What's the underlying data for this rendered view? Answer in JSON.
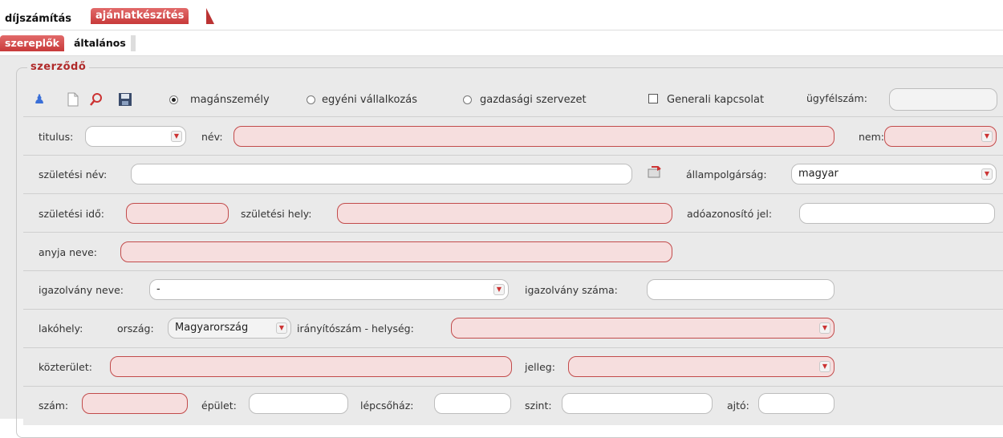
{
  "tabs": {
    "main": [
      {
        "label": "díjszámítás"
      },
      {
        "label": "ajánlatkészítés"
      }
    ],
    "sub": [
      {
        "label": "szereplők"
      },
      {
        "label": "általános"
      }
    ]
  },
  "section": {
    "title": "szerződő",
    "radios": [
      {
        "label": "magánszemély",
        "selected": true
      },
      {
        "label": "egyéni vállalkozás",
        "selected": false
      },
      {
        "label": "gazdasági szervezet",
        "selected": false
      }
    ],
    "generali_checkbox": {
      "label": "Generali kapcsolat",
      "checked": false
    },
    "client_id_label": "ügyfélszám:"
  },
  "fields": {
    "titulus": {
      "label": "titulus:",
      "value": ""
    },
    "nev": {
      "label": "név:",
      "value": ""
    },
    "nem": {
      "label": "nem:",
      "value": ""
    },
    "szuletesi_nev": {
      "label": "születési név:",
      "value": ""
    },
    "allampolgarsag": {
      "label": "állampolgárság:",
      "value": "magyar"
    },
    "szuletesi_ido": {
      "label": "születési idő:",
      "value": ""
    },
    "szuletesi_hely": {
      "label": "születési hely:",
      "value": ""
    },
    "adoazonosito": {
      "label": "adóazonosító jel:",
      "value": ""
    },
    "anyja_neve": {
      "label": "anyja neve:",
      "value": ""
    },
    "igazolvany_neve": {
      "label": "igazolvány neve:",
      "value": "-"
    },
    "igazolvany_szama": {
      "label": "igazolvány száma:",
      "value": ""
    },
    "lakohely": {
      "label": "lakóhely:"
    },
    "orszag": {
      "label": "ország:",
      "value": "Magyarország"
    },
    "iranyitoszam": {
      "label": "irányítószám - helység:",
      "value": ""
    },
    "kozterulet": {
      "label": "közterület:",
      "value": ""
    },
    "jelleg": {
      "label": "jelleg:",
      "value": ""
    },
    "szam": {
      "label": "szám:",
      "value": ""
    },
    "epulet": {
      "label": "épület:",
      "value": ""
    },
    "lepcsohaz": {
      "label": "lépcsőház:",
      "value": ""
    },
    "szint": {
      "label": "szint:",
      "value": ""
    },
    "ajto": {
      "label": "ajtó:",
      "value": ""
    }
  },
  "toolbar_icons": [
    "people-icon",
    "new-document-icon",
    "search-icon",
    "save-icon"
  ],
  "colors": {
    "accent": "#c83a3a",
    "required_bg": "#f6dede",
    "panel_bg": "#eaeaea"
  }
}
